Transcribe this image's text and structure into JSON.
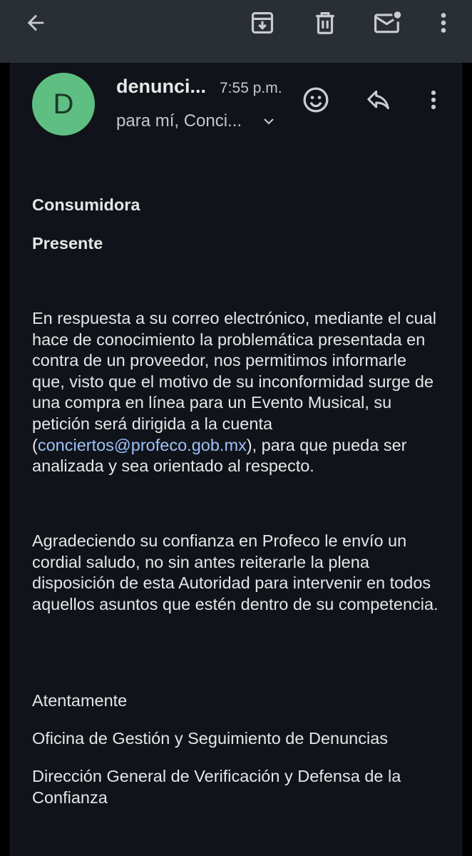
{
  "toolbar": {
    "back_icon": "arrow-back-icon",
    "archive_icon": "archive-icon",
    "delete_icon": "trash-icon",
    "mark_unread_icon": "mail-unread-icon",
    "more_icon": "more-vert-icon"
  },
  "email": {
    "avatar_letter": "D",
    "avatar_color": "#5fbf83",
    "sender": "denunci...",
    "time": "7:55 p.m.",
    "recipients": "para mí, Conci...",
    "greeting_1": "Consumidora",
    "greeting_2": "Presente",
    "para1_before": "En respuesta a su  correo electrónico, mediante el cual hace de conocimiento la problemática presentada en contra de un proveedor, nos permitimos informarle que, visto que el motivo de su inconformidad surge de una compra en línea para un Evento Musical, su petición será dirigida a la cuenta (",
    "para1_link": "conciertos@profeco.gob.mx",
    "para1_after": "), para que pueda ser analizada y sea orientado al respecto.",
    "para2": "Agradeciendo su confianza en Profeco le envío un cordial saludo, no sin antes reiterarle la plena disposición de esta Autoridad para intervenir en todos aquellos asuntos que estén dentro de su competencia.",
    "signoff": "Atentamente",
    "office": "Oficina de Gestión y Seguimiento de Denuncias",
    "direction": "Dirección General de Verificación y Defensa de la Confianza"
  },
  "colors": {
    "toolbar_bg": "#2a2f36",
    "content_bg": "#10131a",
    "link": "#9ec1f7"
  }
}
